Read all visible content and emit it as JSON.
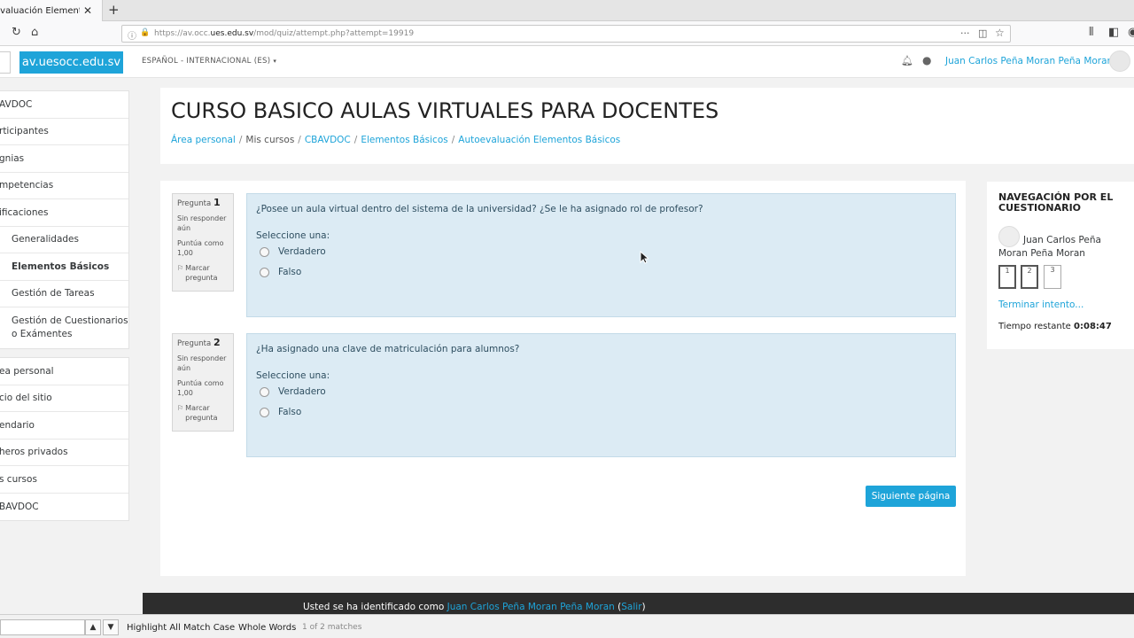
{
  "browser": {
    "tab_title": "evaluación Elemento",
    "tab_close": "✕",
    "new_tab": "+",
    "url_prefix": "https://av.occ.",
    "url_domain": "ues.edu.sv",
    "url_path": "/mod/quiz/attempt.php?attempt=19919"
  },
  "header": {
    "brand": "av.uesocc.edu.sv",
    "language": "ESPAÑOL - INTERNACIONAL (ES)",
    "user_name": "Juan Carlos Peña Moran Peña Moran"
  },
  "sidebar": {
    "course_items": [
      "AVDOC",
      "rticipantes",
      "gnias",
      "mpetencias",
      "ificaciones"
    ],
    "sections": [
      "Generalidades",
      "Elementos Básicos",
      "Gestión de Tareas",
      "Gestión de Cuestionarios o Exámentes"
    ],
    "nav_items": [
      "ea personal",
      "cio del sitio",
      "endario",
      "heros privados",
      "s cursos",
      "BAVDOC"
    ]
  },
  "page": {
    "title": "CURSO BASICO AULAS VIRTUALES PARA DOCENTES",
    "breadcrumb": [
      "Área personal",
      "Mis cursos",
      "CBAVDOC",
      "Elementos Básicos",
      "Autoevaluación Elementos Básicos"
    ]
  },
  "questions": [
    {
      "label": "Pregunta",
      "number": "1",
      "status": "Sin responder aún",
      "score": "Puntúa como 1,00",
      "flag": "Marcar pregunta",
      "text": "¿Posee un aula virtual dentro del sistema de la universidad? ¿Se le ha asignado rol de profesor?",
      "prompt": "Seleccione una:",
      "options": [
        "Verdadero",
        "Falso"
      ]
    },
    {
      "label": "Pregunta",
      "number": "2",
      "status": "Sin responder aún",
      "score": "Puntúa como 1,00",
      "flag": "Marcar pregunta",
      "text": "¿Ha asignado una clave de matriculación para alumnos?",
      "prompt": "Seleccione una:",
      "options": [
        "Verdadero",
        "Falso"
      ]
    }
  ],
  "next_button": "Siguiente página",
  "quiz_nav": {
    "title": "NAVEGACIÓN POR EL CUESTIONARIO",
    "user": "Juan Carlos Peña Moran Peña Moran",
    "pages": [
      "1",
      "2",
      "3"
    ],
    "finish": "Terminar intento...",
    "time_label": "Tiempo restante",
    "time_value": "0:08:47"
  },
  "footer": {
    "prefix": "Usted se ha identificado como",
    "user": "Juan Carlos Peña Moran Peña Moran",
    "logout": "Salir"
  },
  "findbar": {
    "highlight_all": "Highlight All",
    "match_case": "Match Case",
    "whole_words": "Whole Words",
    "status": "1 of 2 matches"
  }
}
